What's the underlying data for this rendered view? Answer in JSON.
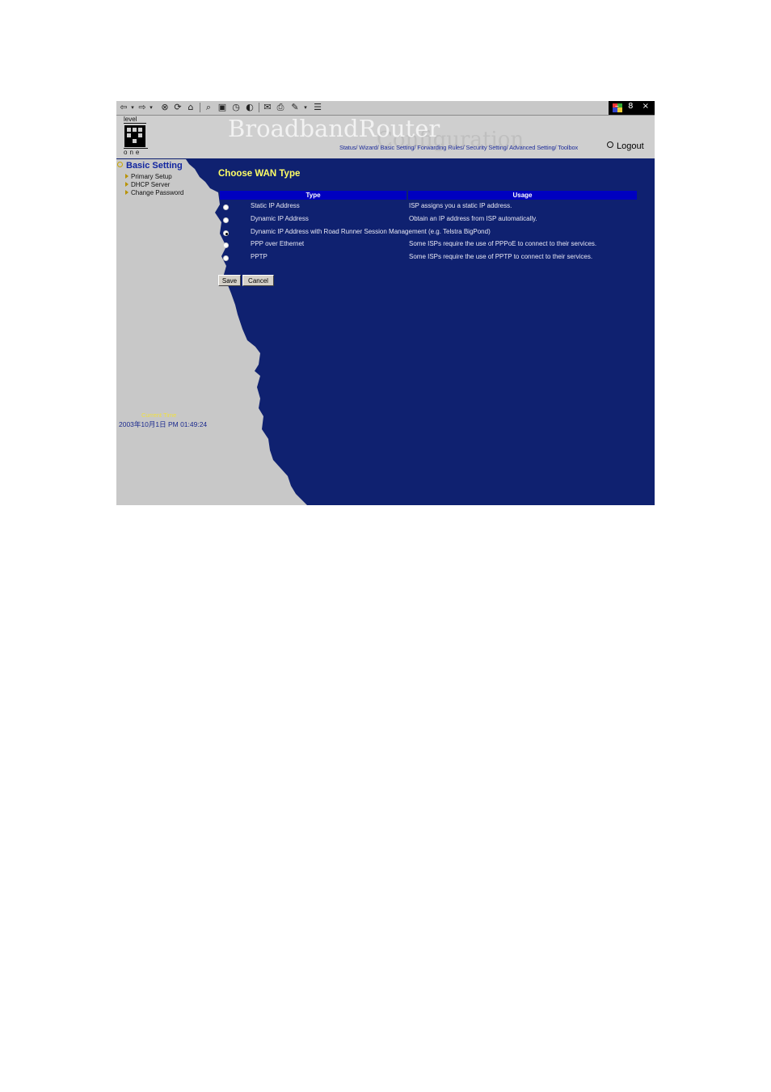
{
  "toolbar": {
    "icons": [
      "back-icon",
      "dropdown-icon",
      "forward-icon",
      "dropdown-icon",
      "stop-icon",
      "refresh-icon",
      "home-icon",
      "search-icon",
      "favorites-icon",
      "history-icon",
      "media-icon",
      "mail-icon",
      "print-icon",
      "edit-icon",
      "dropdown-icon",
      "discuss-icon"
    ],
    "window_buttons": "– 8 ×"
  },
  "header": {
    "logo_top": "level",
    "logo_bottom": "one",
    "title_main": "BroadbandRouter",
    "title_sub": "Configuration",
    "nav_links": "Status/ Wizard/ Basic Setting/ Forwarding Rules/ Security Setting/ Advanced Setting/ Toolbox",
    "logout": "Logout"
  },
  "sidebar": {
    "title": "Basic Setting",
    "items": [
      "Primary Setup",
      "DHCP Server",
      "Change Password"
    ],
    "current_time_label": "Current Time",
    "current_time_value": "2003年10月1日 PM 01:49:24"
  },
  "main": {
    "title": "Choose WAN Type",
    "columns": [
      "Type",
      "Usage"
    ],
    "rows": [
      {
        "type": "Static IP Address",
        "usage": "ISP assigns you a static IP address.",
        "selected": false
      },
      {
        "type": "Dynamic IP Address",
        "usage": "Obtain an IP address from ISP automatically.",
        "selected": false
      },
      {
        "type": "Dynamic IP Address with Road Runner Session Management (e.g. Telstra BigPond)",
        "usage": "",
        "selected": true
      },
      {
        "type": "PPP over Ethernet",
        "usage": "Some ISPs require the use of PPPoE to connect to their services.",
        "selected": false
      },
      {
        "type": "PPTP",
        "usage": "Some ISPs require the use of PPTP to connect to their services.",
        "selected": false
      }
    ],
    "save_label": "Save",
    "cancel_label": "Cancel"
  },
  "colors": {
    "page_background": "#0f2170",
    "sidebar_background": "#c8c8c8",
    "table_header": "#0000c0",
    "title_yellow": "#ffff66"
  }
}
